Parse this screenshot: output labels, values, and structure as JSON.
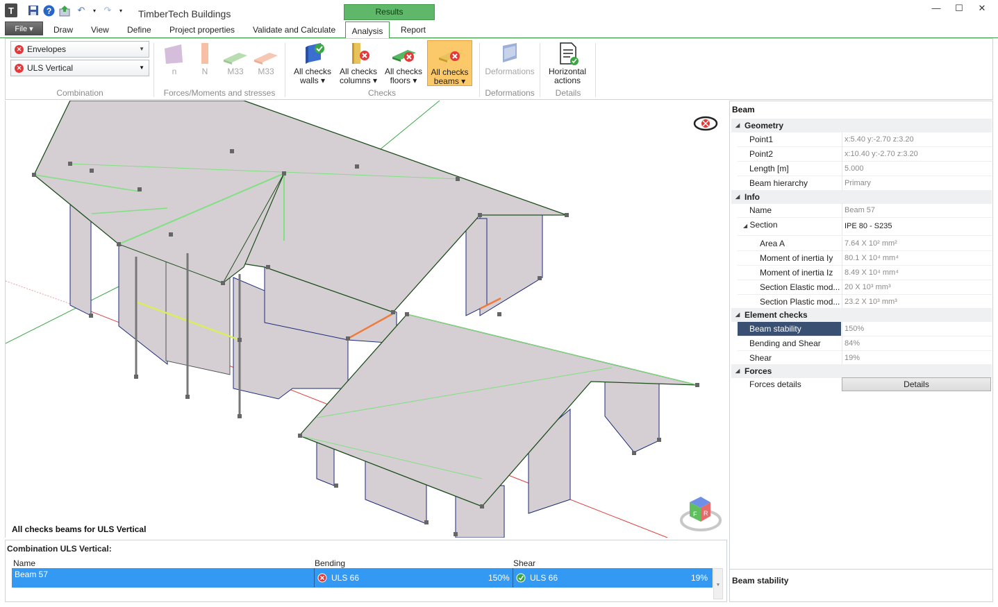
{
  "app": {
    "title": "TimberTech Buildings",
    "context_tab": "Results"
  },
  "menu": {
    "file": "File",
    "tabs": [
      "Draw",
      "View",
      "Define",
      "Project properties",
      "Validate and Calculate",
      "Analysis",
      "Report"
    ],
    "active_tab": "Analysis"
  },
  "ribbon": {
    "combination": {
      "type_value": "Envelopes",
      "combo_value": "ULS Vertical",
      "group_label": "Combination"
    },
    "forces": {
      "buttons": [
        "n",
        "N",
        "M33",
        "M33"
      ],
      "group_label": "Forces/Moments and stresses"
    },
    "checks": {
      "buttons": [
        {
          "line1": "All checks",
          "line2": "walls"
        },
        {
          "line1": "All checks",
          "line2": "columns"
        },
        {
          "line1": "All checks",
          "line2": "floors"
        },
        {
          "line1": "All checks",
          "line2": "beams"
        }
      ],
      "group_label": "Checks"
    },
    "deformations": {
      "button": "Deformations",
      "group_label": "Deformations"
    },
    "details": {
      "line1": "Horizontal",
      "line2": "actions",
      "group_label": "Details"
    }
  },
  "viewport": {
    "caption": "All checks beams for ULS Vertical"
  },
  "bottom": {
    "title": "Combination ULS Vertical:",
    "columns": [
      "Name",
      "Bending",
      "Shear"
    ],
    "rows": [
      {
        "name": "Beam 57",
        "bending_combo": "ULS 66",
        "bending_pct": "150%",
        "shear_combo": "ULS 66",
        "shear_pct": "19%"
      }
    ]
  },
  "properties": {
    "header": "Beam",
    "geometry": {
      "title": "Geometry",
      "point1_label": "Point1",
      "point1": "x:5.40 y:-2.70 z:3.20",
      "point2_label": "Point2",
      "point2": "x:10.40 y:-2.70 z:3.20",
      "length_label": "Length [m]",
      "length": "5.000",
      "hier_label": "Beam hierarchy",
      "hier": "Primary"
    },
    "info": {
      "title": "Info",
      "name_label": "Name",
      "name": "Beam 57",
      "section_label": "Section",
      "section": "IPE 80 - S235",
      "area_label": "Area A",
      "area": "7.64 X 10² mm²",
      "iy_label": "Moment of inertia Iy",
      "iy": "80.1 X 10⁴ mm⁴",
      "iz_label": "Moment of inertia Iz",
      "iz": "8.49 X 10⁴ mm⁴",
      "wel_label": "Section Elastic mod...",
      "wel": "20 X 10³ mm³",
      "wpl_label": "Section Plastic mod...",
      "wpl": "23.2 X 10³ mm³"
    },
    "checks": {
      "title": "Element checks",
      "stab_label": "Beam stability",
      "stab": "150%",
      "bend_label": "Bending and Shear",
      "bend": "84%",
      "shear_label": "Shear",
      "shear": "19%"
    },
    "forces": {
      "title": "Forces",
      "details_label": "Forces details",
      "details_btn": "Details"
    },
    "description_title": "Beam stability"
  },
  "colors": {
    "accent": "#3f9a4a",
    "selection": "#3399f3",
    "fail": "#e23a3a",
    "pass": "#3aa646",
    "roof": "#d5cfd3"
  }
}
